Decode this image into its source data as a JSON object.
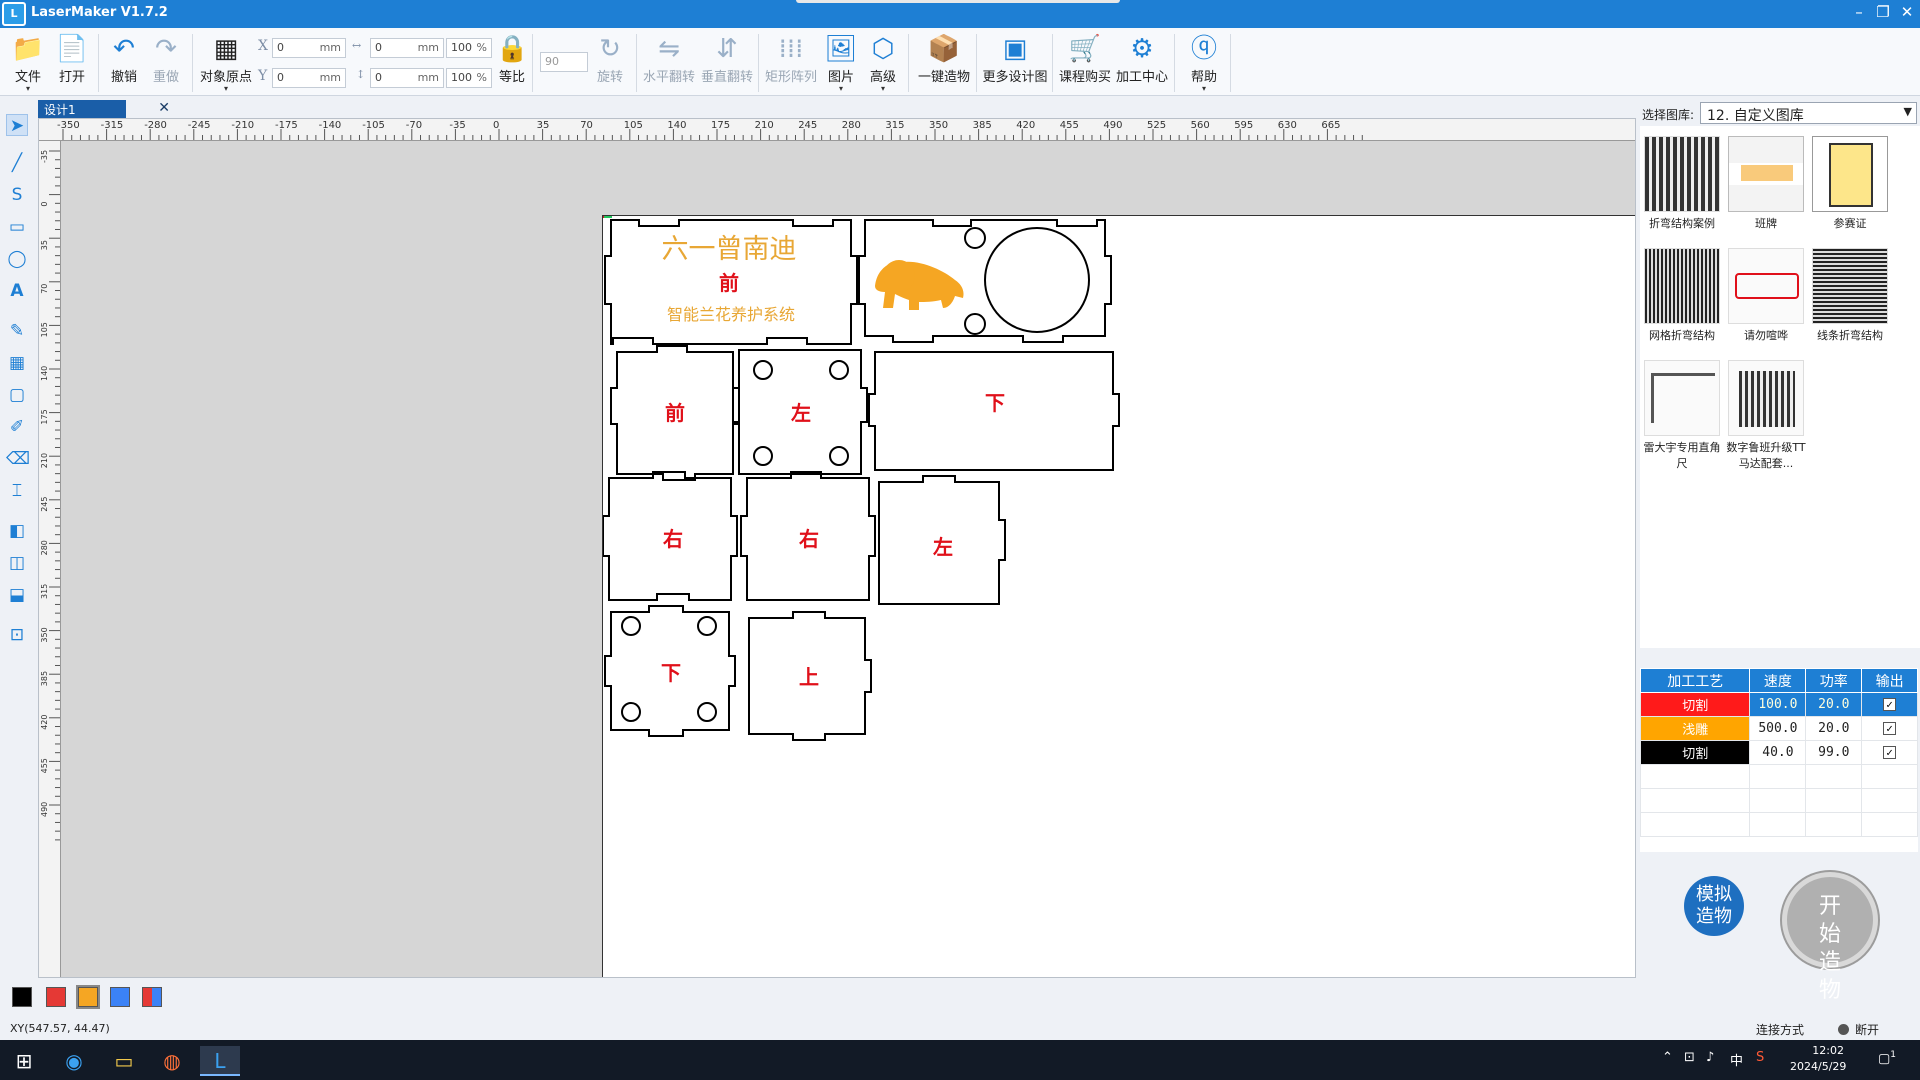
{
  "app": {
    "title": "LaserMaker V1.7.2",
    "icon_text": "L"
  },
  "toolbar": {
    "file": "文件",
    "open": "打开",
    "undo": "撤销",
    "redo": "重做",
    "origin": "对象原点",
    "lock_ratio": "等比",
    "rotate": "旋转",
    "flip_h": "水平翻转",
    "flip_v": "垂直翻转",
    "array": "矩形阵列",
    "image": "图片",
    "advanced": "高级",
    "one_click": "一键造物",
    "more_designs": "更多设计图",
    "course_shop": "课程购买",
    "process_center": "加工中心",
    "help": "帮助",
    "x_label": "X",
    "y_label": "Y",
    "x_value": "0",
    "y_value": "0",
    "w_value": "0",
    "h_value": "0",
    "unit": "mm",
    "w_pct": "100",
    "h_pct": "100",
    "pct": "%",
    "rotate_value": "90"
  },
  "tab": {
    "name": "设计1",
    "close": "✕"
  },
  "ruler": {
    "h_ticks": [
      "-350",
      "-315",
      "-280",
      "-245",
      "-210",
      "-175",
      "-140",
      "-105",
      "-70",
      "-35",
      "0",
      "35",
      "70",
      "105",
      "140",
      "175",
      "210",
      "245",
      "280",
      "315",
      "350",
      "385",
      "420",
      "455",
      "490",
      "525",
      "560",
      "595",
      "630",
      "665"
    ],
    "v_ticks": [
      "-35",
      "0",
      "35",
      "70",
      "105",
      "140",
      "175",
      "210",
      "245",
      "280",
      "315",
      "350",
      "385",
      "420",
      "455",
      "490"
    ]
  },
  "design": {
    "title": "六一曾南迪",
    "front": "前",
    "subtitle": "智能兰花养护系统",
    "labels": [
      "前",
      "左",
      "下",
      "右",
      "右",
      "左",
      "下",
      "上"
    ],
    "lion_color": "#f5a623",
    "cut_color": "#e0101a",
    "engrave_color": "#e8a735"
  },
  "library": {
    "label": "选择图库:",
    "selected": "12. 自定义图库",
    "items": [
      "折弯结构案例",
      "班牌",
      "参赛证",
      "网格折弯结构",
      "请勿喧哗",
      "线条折弯结构",
      "雷大宇专用直角尺",
      "数字鲁班升级TT马达配套..."
    ]
  },
  "process": {
    "headers": [
      "加工工艺",
      "速度",
      "功率",
      "输出"
    ],
    "rows": [
      {
        "name": "切割",
        "speed": "100.0",
        "power": "20.0",
        "color": "#ff1a1a",
        "checked": "✓"
      },
      {
        "name": "浅雕",
        "speed": "500.0",
        "power": "20.0",
        "color": "#ffa500",
        "checked": "✓"
      },
      {
        "name": "切割",
        "speed": "40.0",
        "power": "99.0",
        "color": "#000000",
        "checked": "✓"
      }
    ]
  },
  "buttons": {
    "simulate": "模拟造物",
    "start": "开始造物"
  },
  "palette": [
    "#000000",
    "#e53935",
    "#f5a623",
    "#3b82f6",
    "#multi"
  ],
  "status": {
    "coords": "XY(547.57, 44.47)",
    "conn_label": "连接方式",
    "conn_state": "断开"
  },
  "taskbar": {
    "time": "12:02",
    "date": "2024/5/29",
    "ime": "中",
    "notif": "1"
  }
}
